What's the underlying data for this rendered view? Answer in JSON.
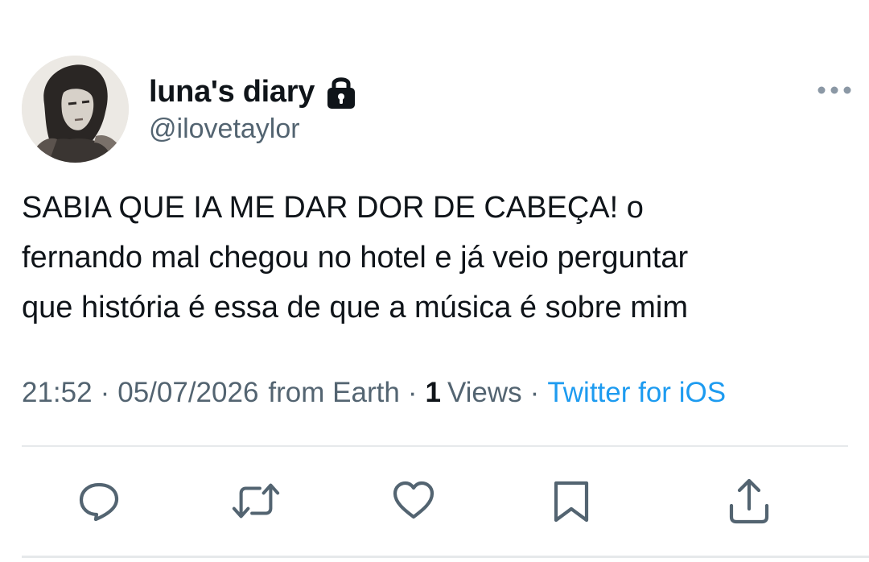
{
  "author": {
    "display_name": "luna's diary",
    "handle": "@ilovetaylor",
    "avatar_icon": "profile-photo",
    "protected_icon": "lock-icon"
  },
  "tweet": {
    "lines": [
      "SABIA QUE IA ME DAR DOR DE CABEÇA! o",
      "fernando mal chegou no hotel e já veio perguntar",
      "que história é essa de que a música é sobre mim"
    ]
  },
  "meta": {
    "time": "21:52",
    "separator": "·",
    "date": "05/07/2026",
    "location": "from Earth",
    "views_count": "1",
    "views_label": "Views",
    "source": "Twitter for iOS"
  },
  "actions": [
    {
      "name": "reply",
      "icon": "reply-icon"
    },
    {
      "name": "retweet",
      "icon": "retweet-icon"
    },
    {
      "name": "like",
      "icon": "heart-icon"
    },
    {
      "name": "bookmark",
      "icon": "bookmark-icon"
    },
    {
      "name": "share",
      "icon": "share-icon"
    }
  ],
  "colors": {
    "text": "#0f1419",
    "secondary": "#536471",
    "link": "#1d9bf0",
    "divider": "#e6e9eb"
  }
}
